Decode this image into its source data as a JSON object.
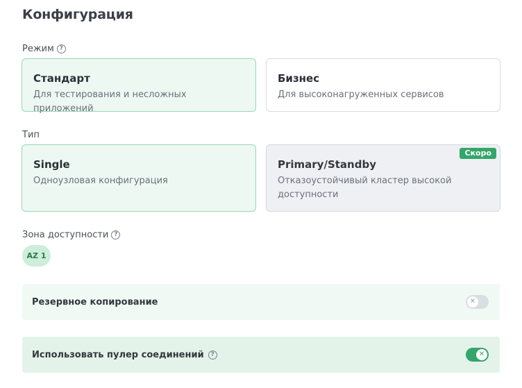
{
  "title": "Конфигурация",
  "mode": {
    "label": "Режим",
    "help_icon": "question-circle-icon",
    "options": [
      {
        "title": "Стандарт",
        "description": "Для тестирования и несложных приложений",
        "state": "selected"
      },
      {
        "title": "Бизнес",
        "description": "Для высоконагруженных сервисов",
        "state": "default"
      }
    ]
  },
  "type": {
    "label": "Тип",
    "options": [
      {
        "title": "Single",
        "description": "Одноузловая конфигурация",
        "state": "selected"
      },
      {
        "title": "Primary/Standby",
        "description": "Отказоустойчивый кластер высокой доступности",
        "state": "disabled",
        "badge": "Скоро"
      }
    ]
  },
  "zone": {
    "label": "Зона доступности",
    "help_icon": "question-circle-icon",
    "chips": [
      "AZ 1"
    ]
  },
  "backup": {
    "label": "Резервное копирование",
    "enabled": false
  },
  "pooler": {
    "label": "Использовать пулер соединений",
    "help_icon": "question-circle-icon",
    "enabled": true
  },
  "colors": {
    "accent": "#35a66a",
    "selected_bg": "#eef8f2",
    "selected_border": "#97d8b4",
    "disabled_bg": "#eff0f4"
  }
}
